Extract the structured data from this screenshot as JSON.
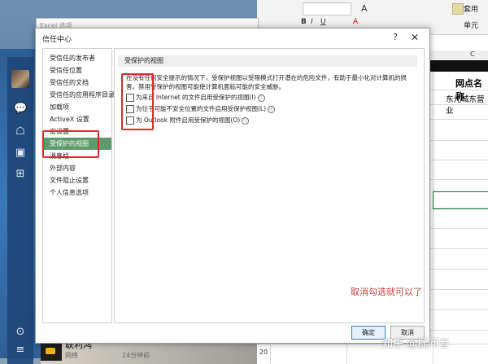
{
  "excel": {
    "ribbon_row1": [
      "B",
      "I",
      "U",
      "A",
      "A"
    ],
    "format_label": "套用",
    "cell_style_label": "单元",
    "column_c": "C",
    "header_cell": "网点名称",
    "row_text": "东光城东营业",
    "row_number": "20"
  },
  "qq": {
    "contact_name": "联利鸿",
    "contact_sub": "网络",
    "time": "24分钟前"
  },
  "backwin": {
    "title": "Excel 选项"
  },
  "dialog": {
    "title": "信任中心",
    "help": "?",
    "close": "✕",
    "nav": [
      "受信任的发布者",
      "受信任位置",
      "受信任的文档",
      "受信任的应用程序目录",
      "加载项",
      "ActiveX 设置",
      "宏设置",
      "受保护的视图",
      "消息栏",
      "外部内容",
      "文件阻止设置",
      "个人信息选项"
    ],
    "active_index": 7,
    "section_title": "受保护的视图",
    "description": "在没有任何安全提示的情况下，受保护视图以受限模式打开潜在的危险文件，有助于最小化对计算机的损害。禁用受保护的视图可能使计算机面临可能的安全威胁。",
    "options": [
      {
        "label": "为来自 Internet 的文件启用受保护的视图(I)",
        "info": "ⓘ",
        "checked": false
      },
      {
        "label": "为位于可能不安全位置的文件启用受保护视图(L)",
        "info": "ⓘ",
        "checked": false
      },
      {
        "label": "为 Outlook 附件启用受保护的视图(O)",
        "info": "ⓘ",
        "checked": false
      }
    ],
    "ok": "确定",
    "cancel": "取消"
  },
  "annotation": "取消勾选就可以了",
  "watermark": "知乎 @提问者",
  "colors": {
    "active_nav": "#5e9b6b",
    "annotation_red": "#e2282b",
    "primary_button_border": "#3c7fd3"
  }
}
